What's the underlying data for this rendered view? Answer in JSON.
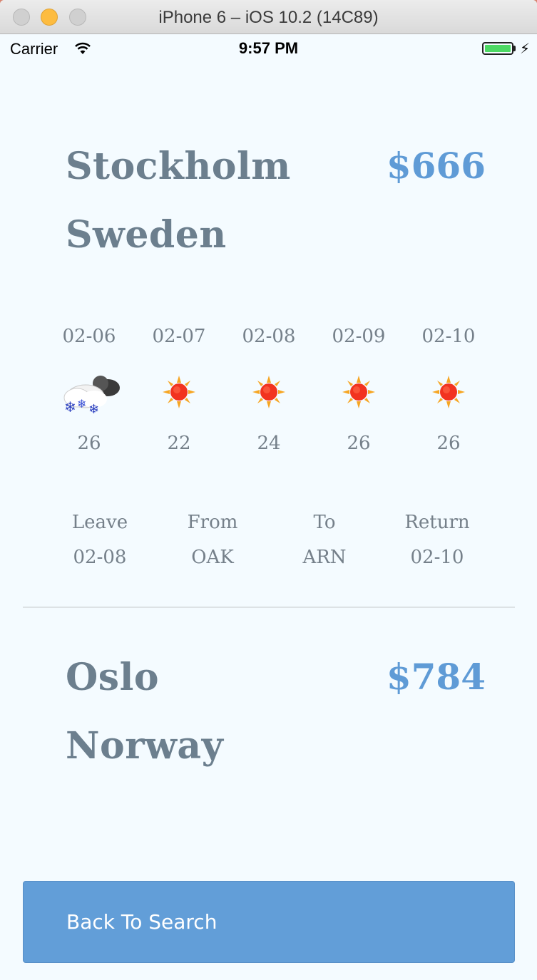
{
  "window": {
    "title": "iPhone 6 – iOS 10.2 (14C89)"
  },
  "status_bar": {
    "carrier": "Carrier",
    "time": "9:57 PM"
  },
  "destinations": [
    {
      "city": "Stockholm",
      "country": "Sweden",
      "price": "$666",
      "forecast": [
        {
          "date": "02-06",
          "icon": "snow-cloud-icon",
          "temp": "26"
        },
        {
          "date": "02-07",
          "icon": "sun-icon",
          "temp": "22"
        },
        {
          "date": "02-08",
          "icon": "sun-icon",
          "temp": "24"
        },
        {
          "date": "02-09",
          "icon": "sun-icon",
          "temp": "26"
        },
        {
          "date": "02-10",
          "icon": "sun-icon",
          "temp": "26"
        }
      ],
      "flight": {
        "leave_label": "Leave",
        "leave_value": "02-08",
        "from_label": "From",
        "from_value": "OAK",
        "to_label": "To",
        "to_value": "ARN",
        "return_label": "Return",
        "return_value": "02-10"
      }
    },
    {
      "city": "Oslo",
      "country": "Norway",
      "price": "$784"
    }
  ],
  "back_button": {
    "label": "Back To Search"
  },
  "colors": {
    "title_gray": "#6c7f8e",
    "price_blue": "#5f9bd6",
    "button_blue": "#629ed8",
    "background": "#f4fbff"
  }
}
